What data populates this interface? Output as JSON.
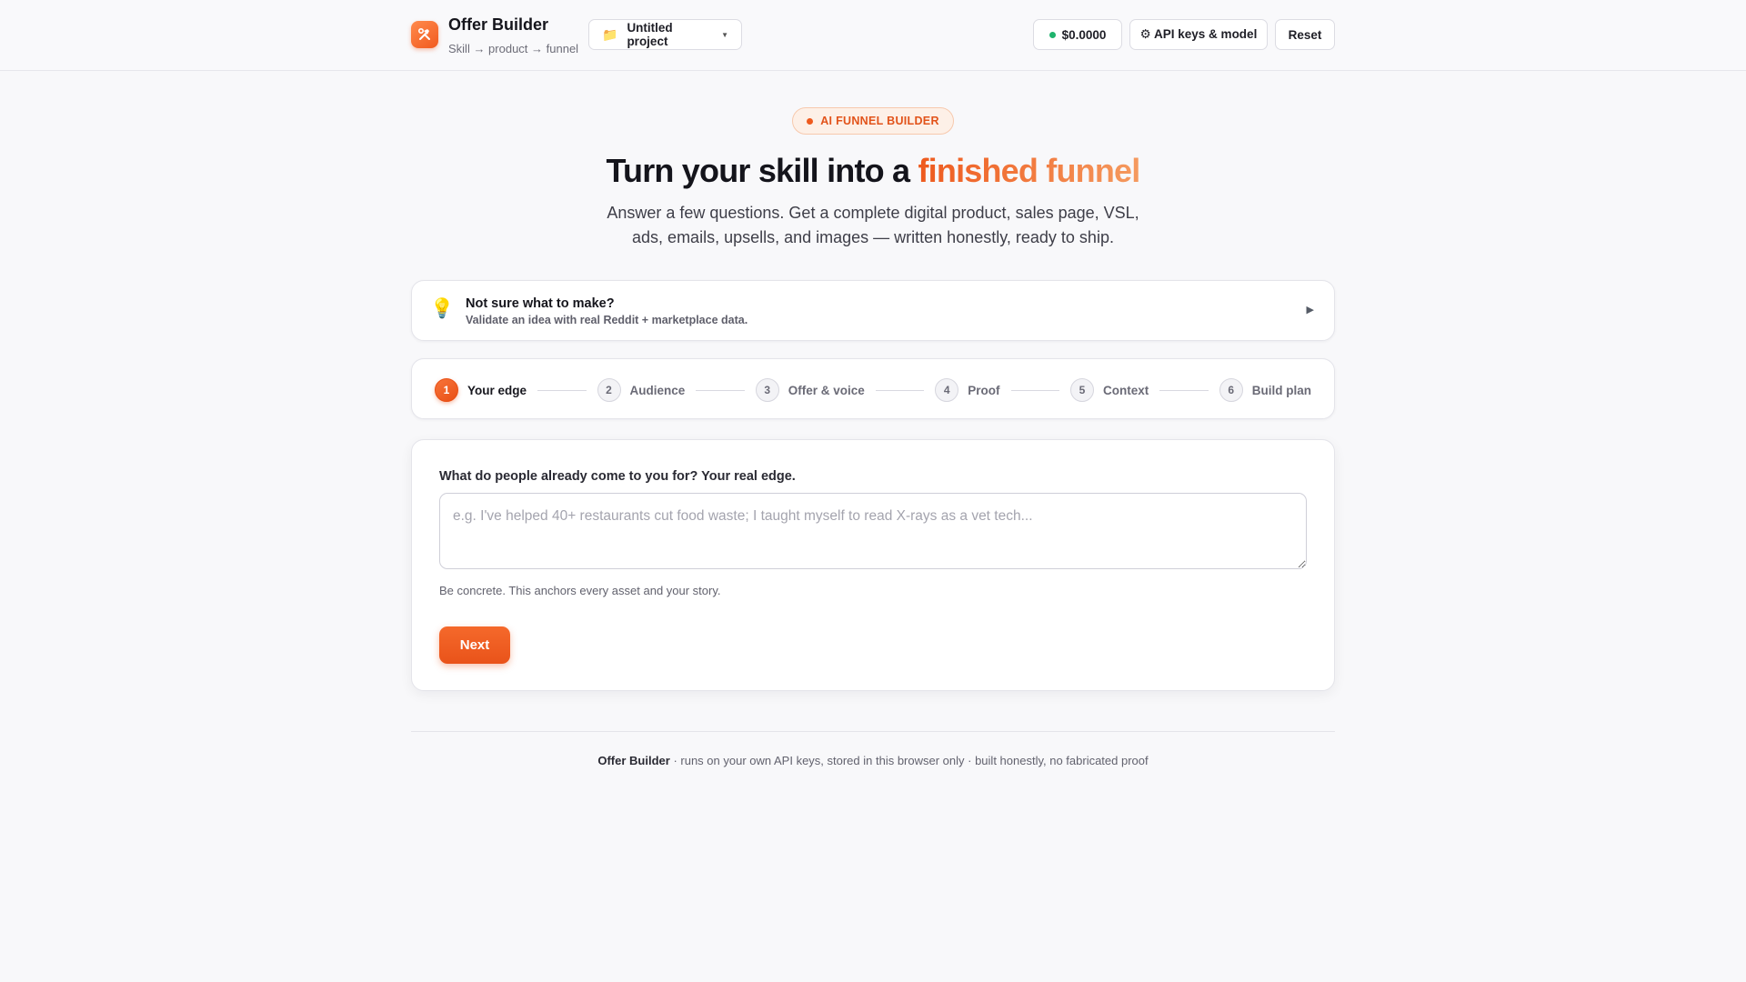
{
  "header": {
    "app_title": "Offer Builder",
    "app_subtitle": "Skill → product → funnel",
    "project_label": "Untitled project",
    "cost": "$0.0000",
    "api_label": "⚙ API keys & model",
    "reset_label": "Reset"
  },
  "hero": {
    "badge": "AI FUNNEL BUILDER",
    "title_prefix": "Turn your skill into a ",
    "title_accent": "finished funnel",
    "description": "Answer a few questions. Get a complete digital product, sales page, VSL, ads, emails, upsells, and images — written honestly, ready to ship."
  },
  "idea_card": {
    "title": "Not sure what to make?",
    "subtitle": "Validate an idea with real Reddit + marketplace data."
  },
  "steps": [
    {
      "num": "1",
      "label": "Your edge",
      "active": true
    },
    {
      "num": "2",
      "label": "Audience"
    },
    {
      "num": "3",
      "label": "Offer & voice"
    },
    {
      "num": "4",
      "label": "Proof"
    },
    {
      "num": "5",
      "label": "Context"
    },
    {
      "num": "6",
      "label": "Build plan"
    }
  ],
  "form": {
    "question": "What do people already come to you for? Your real edge.",
    "placeholder": "e.g. I've helped 40+ restaurants cut food waste; I taught myself to read X-rays as a vet tech...",
    "value": "",
    "hint": "Be concrete. This anchors every asset and your story.",
    "next_label": "Next"
  },
  "footer": {
    "brand": "Offer Builder",
    "text": " · runs on your own API keys, stored in this browser only · built honestly, no fabricated proof"
  },
  "colors": {
    "accent": "#ee5a1e",
    "accent_light": "#f59a5f",
    "success": "#1fb36d",
    "background": "#f8f8fa"
  },
  "icons": {
    "logo": "hammer-wrench-icon",
    "project": "folder-icon",
    "dropdown": "caret-down-icon",
    "idea": "lightbulb-icon",
    "expand": "play-triangle-icon"
  }
}
